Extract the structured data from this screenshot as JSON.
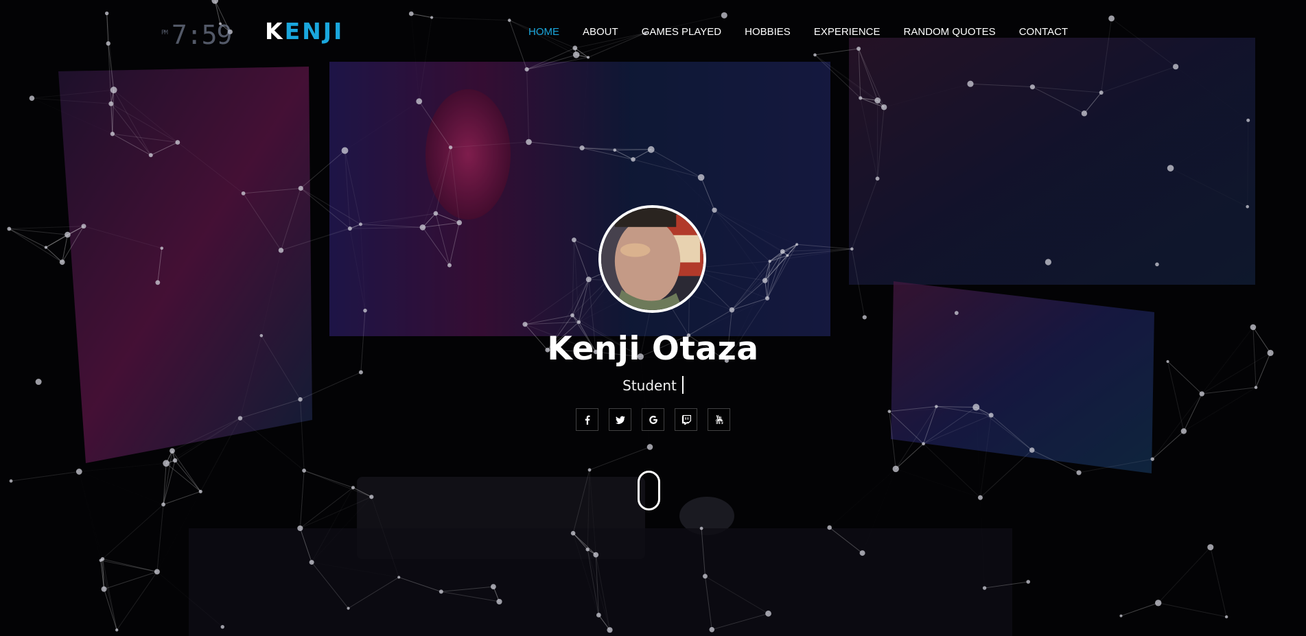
{
  "page": {
    "title": "Kenji Otaza"
  },
  "brand": {
    "logo_first": "K",
    "logo_rest": "ENJI"
  },
  "clock": {
    "period": "PM",
    "time": "7:59"
  },
  "nav": {
    "items": [
      {
        "label": "HOME",
        "active": true
      },
      {
        "label": "ABOUT",
        "active": false
      },
      {
        "label": "GAMES PLAYED",
        "active": false
      },
      {
        "label": "HOBBIES",
        "active": false
      },
      {
        "label": "EXPERIENCE",
        "active": false
      },
      {
        "label": "RANDOM QUOTES",
        "active": false
      },
      {
        "label": "CONTACT",
        "active": false
      }
    ]
  },
  "hero": {
    "name": "Kenji Otaza",
    "role": "Student",
    "socials": [
      "facebook-icon",
      "twitter-icon",
      "google-icon",
      "twitch-icon",
      "youtube-icon"
    ]
  },
  "colors": {
    "accent": "#1aa7dd",
    "text": "#ffffff",
    "background": "#07060b"
  }
}
